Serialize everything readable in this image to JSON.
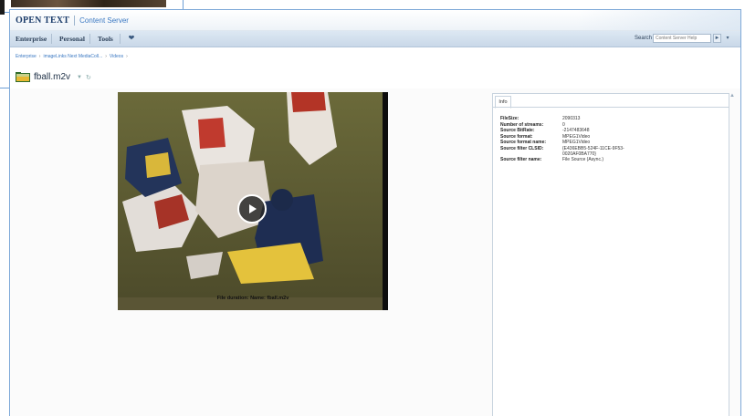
{
  "app": {
    "brand": "OPEN TEXT",
    "product": "Content Server"
  },
  "menu": {
    "items": [
      "Enterprise",
      "Personal",
      "Tools"
    ]
  },
  "search": {
    "label": "Search",
    "placeholder": "Content Server Help"
  },
  "breadcrumb": [
    "Enterprise",
    "imageLinks Next MediaColl...",
    "Videos"
  ],
  "page": {
    "title": "fball.m2v"
  },
  "video": {
    "caption": "File duration: Name: fball.m2v"
  },
  "info_panel": {
    "tab_label": "Info",
    "rows": [
      {
        "key": "FileSize:",
        "value": "2090313"
      },
      {
        "key": "Number of streams:",
        "value": "0"
      },
      {
        "key": "Source BitRate:",
        "value": "-2147483648"
      },
      {
        "key": "Source format:",
        "value": "MPEG1Video"
      },
      {
        "key": "Source format name:",
        "value": "MPEG1Video"
      },
      {
        "key": "Source filter CLSID:",
        "value": "{E436EBB5-524F-11CE-9F53-0020AF0BA770}"
      },
      {
        "key": "Source filter name:",
        "value": "File Source (Async.)"
      }
    ]
  },
  "colors": {
    "accent": "#3a78c2",
    "border": "#7ea9d8",
    "menubar": "#c9d8e8"
  }
}
